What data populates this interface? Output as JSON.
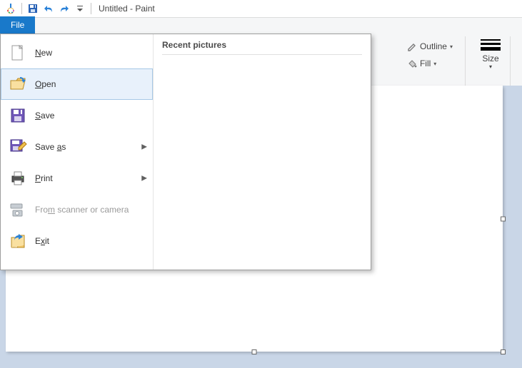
{
  "titlebar": {
    "title_text": "Untitled - Paint",
    "icons": {
      "app": "paint-app-icon",
      "save": "save-icon",
      "undo": "undo-icon",
      "redo": "redo-icon",
      "customize": "customize-qat-icon"
    }
  },
  "ribbon": {
    "file_tab_label": "File",
    "outline_label": "Outline",
    "fill_label": "Fill",
    "size_label": "Size"
  },
  "file_menu": {
    "recent_header": "Recent pictures",
    "items": [
      {
        "id": "new",
        "label": "New",
        "mnemonic": 0,
        "has_submenu": false,
        "enabled": true
      },
      {
        "id": "open",
        "label": "Open",
        "mnemonic": 0,
        "has_submenu": false,
        "enabled": true,
        "hovered": true
      },
      {
        "id": "save",
        "label": "Save",
        "mnemonic": 0,
        "has_submenu": false,
        "enabled": true
      },
      {
        "id": "saveas",
        "label": "Save as",
        "mnemonic": 5,
        "has_submenu": true,
        "enabled": true
      },
      {
        "id": "print",
        "label": "Print",
        "mnemonic": 0,
        "has_submenu": true,
        "enabled": true
      },
      {
        "id": "scanner",
        "label": "From scanner or camera",
        "mnemonic": 3,
        "has_submenu": false,
        "enabled": false
      },
      {
        "id": "exit",
        "label": "Exit",
        "mnemonic": 1,
        "has_submenu": false,
        "enabled": true
      }
    ]
  },
  "colors": {
    "file_tab_bg": "#1979ca",
    "hover_bg": "#e8f1fb",
    "hover_border": "#a6c8e6",
    "workspace_bg": "#c9d6e7"
  }
}
